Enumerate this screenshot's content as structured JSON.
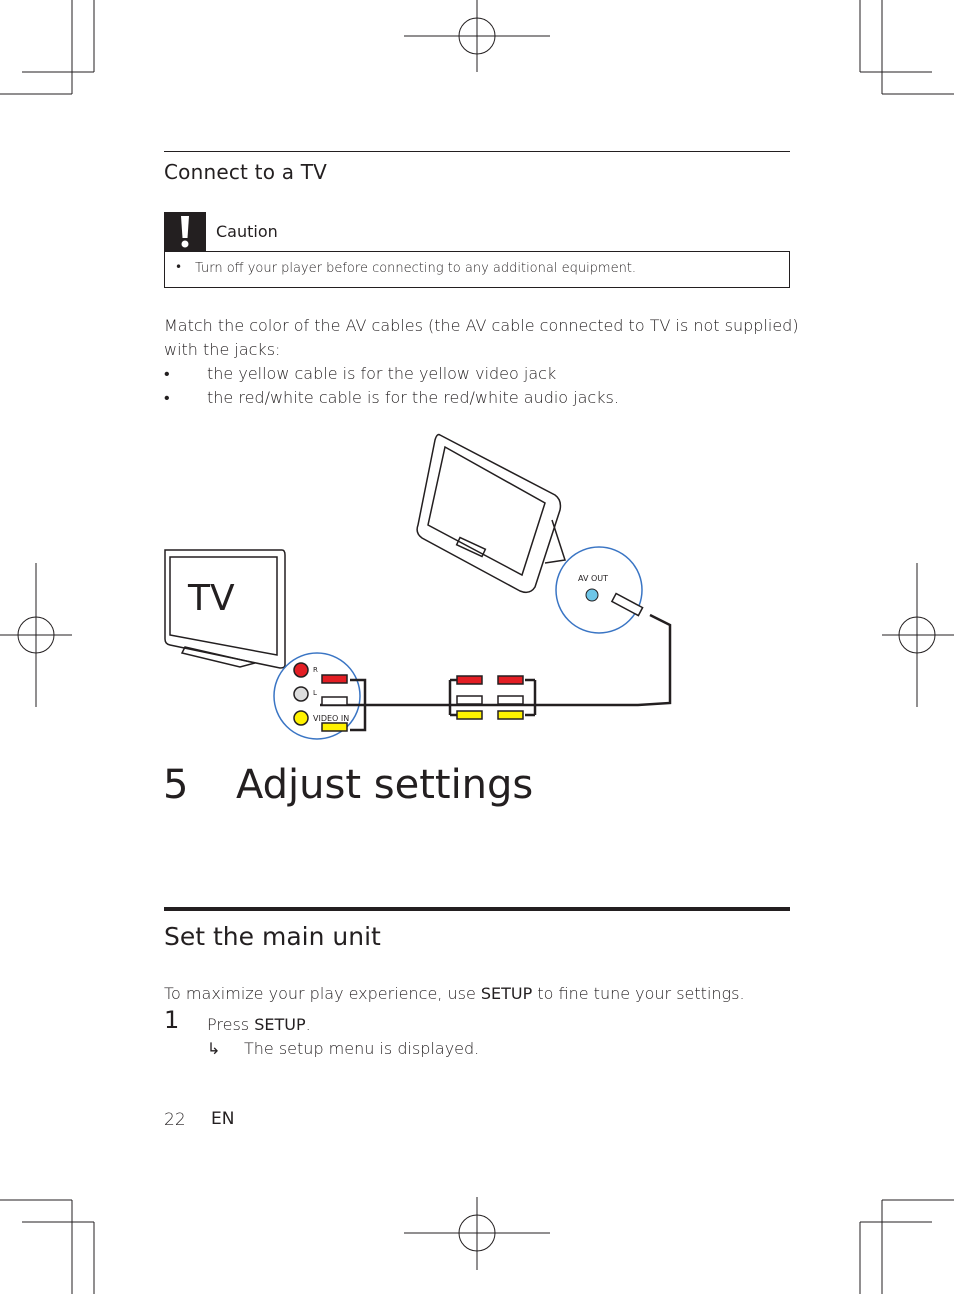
{
  "section": {
    "heading": "Connect to a TV",
    "caution": {
      "title": "Caution",
      "icon": "exclamation-icon",
      "items": [
        "Turn off your player before connecting to any additional equipment."
      ]
    },
    "intro_line1": "Match the color of the AV cables (the AV cable connected to TV is not supplied)",
    "intro_line2": "with the jacks:",
    "bullets": [
      "the yellow cable is for the yellow video jack",
      "the red/white cable is for the red/white audio jacks."
    ],
    "diagram": {
      "tv_label": "TV",
      "jack_r": "R",
      "jack_l": "L",
      "jack_video": "VIDEO IN",
      "av_out": "AV OUT",
      "colors": {
        "red": "#e31e24",
        "white": "#ffffff",
        "yellow": "#fff200",
        "callout": "#3a75c4",
        "jack": "#6ec6e8"
      }
    }
  },
  "chapter": {
    "number": "5",
    "title": "Adjust settings"
  },
  "subsection": {
    "heading": "Set the main unit",
    "para_pre": "To maximize your play experience, use ",
    "para_bold": "SETUP",
    "para_post": " to fine tune your settings.",
    "steps": [
      {
        "number": "1",
        "pre": "Press ",
        "bold": "SETUP",
        "post": ".",
        "result_arrow": "↳",
        "result": "The setup menu is displayed."
      }
    ]
  },
  "footer": {
    "page": "22",
    "lang": "EN"
  }
}
